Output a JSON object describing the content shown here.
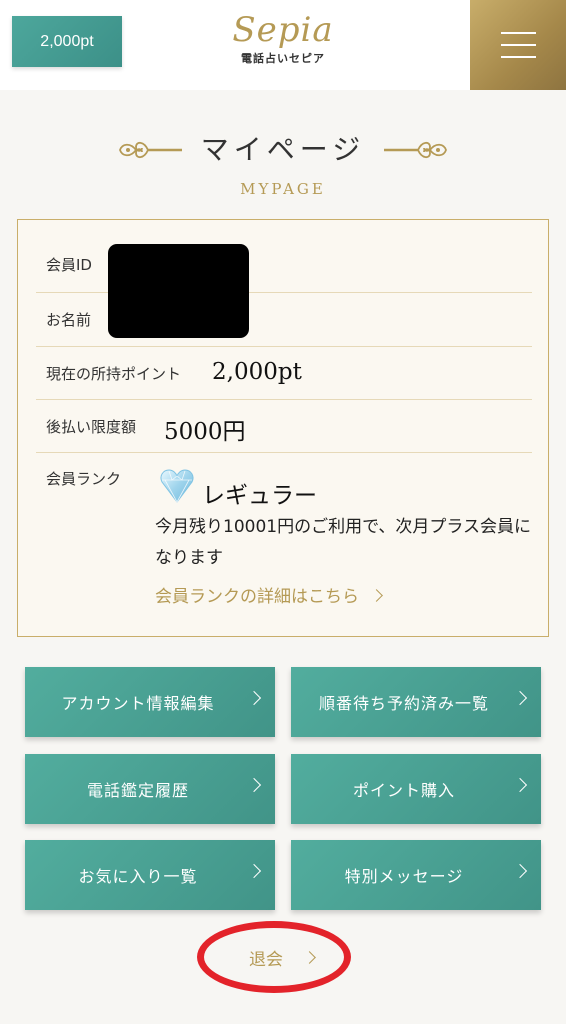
{
  "header": {
    "points_label": "2,000pt",
    "logo_script": "Sepia",
    "logo_sub": "電話占いセピア"
  },
  "page": {
    "title": "マイページ",
    "subtitle": "MYPAGE"
  },
  "member": {
    "id_label": "会員ID",
    "name_label": "お名前",
    "points_label": "現在の所持ポイント",
    "points_value": "2,000pt",
    "deferred_label": "後払い限度額",
    "deferred_value": "5000円",
    "rank_label": "会員ランク",
    "rank_value": "レギュラー",
    "rank_note": "今月残り10001円のご利用で、次月プラス会員になります",
    "rank_link": "会員ランクの詳細はこちら"
  },
  "menu": [
    {
      "label": "アカウント情報編集"
    },
    {
      "label": "順番待ち予約済み一覧"
    },
    {
      "label": "電話鑑定履歴"
    },
    {
      "label": "ポイント購入"
    },
    {
      "label": "お気に入り一覧"
    },
    {
      "label": "特別メッセージ"
    }
  ],
  "quit_label": "退会",
  "colors": {
    "accent_gold": "#b59a55",
    "teal": "#4da79c",
    "highlight_red": "#e3232a"
  }
}
